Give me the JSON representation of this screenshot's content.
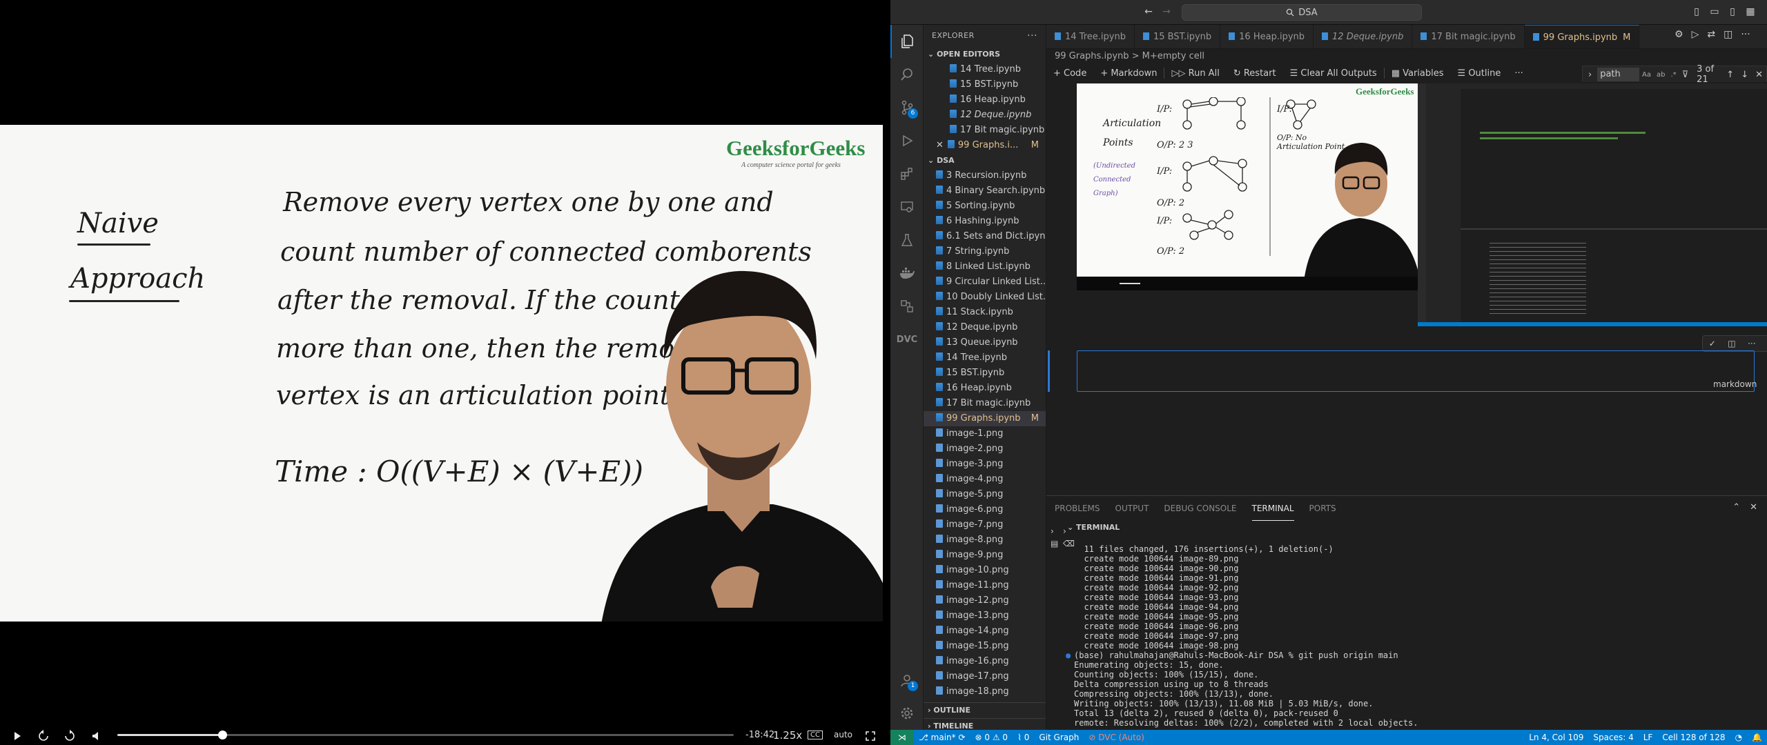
{
  "video": {
    "logo": "GeeksforGeeks",
    "logo_sub": "A computer science portal for geeks",
    "slide": {
      "heading_line1": "Naive",
      "heading_line2": "Approach",
      "body_lines": [
        "Remove every vertex one by one and",
        "count number of connected comborents",
        "after the removal. If the count is",
        "more than one, then the removed",
        "vertex is an articulation point."
      ],
      "time": "Time : O((V+E) × (V+E))"
    },
    "controls": {
      "time_remaining": "-18:42",
      "speed": "1.25x",
      "quality": "auto",
      "progress_fraction": 0.17
    }
  },
  "vscode": {
    "title": "DSA",
    "sidebar": {
      "header": "EXPLORER",
      "open_editors_label": "OPEN EDITORS",
      "open_editors": [
        {
          "label": "14 Tree.ipynb"
        },
        {
          "label": "15 BST.ipynb"
        },
        {
          "label": "16 Heap.ipynb"
        },
        {
          "label": "12 Deque.ipynb",
          "italic": true
        },
        {
          "label": "17 Bit magic.ipynb"
        },
        {
          "label": "99 Graphs.i...",
          "mod": "M",
          "active": true
        }
      ],
      "folder_label": "DSA",
      "files": [
        "3 Recursion.ipynb",
        "4 Binary Search.ipynb",
        "5 Sorting.ipynb",
        "6 Hashing.ipynb",
        "6.1 Sets and Dict.ipynb",
        "7 String.ipynb",
        "8 Linked List.ipynb",
        "9 Circular Linked List....",
        "10 Doubly Linked List....",
        "11 Stack.ipynb",
        "12 Deque.ipynb",
        "13 Queue.ipynb",
        "14 Tree.ipynb",
        "15 BST.ipynb",
        "16 Heap.ipynb",
        "17 Bit magic.ipynb"
      ],
      "active_file": {
        "label": "99 Graphs.ipynb",
        "mod": "M"
      },
      "images": [
        "image-1.png",
        "image-2.png",
        "image-3.png",
        "image-4.png",
        "image-5.png",
        "image-6.png",
        "image-7.png",
        "image-8.png",
        "image-9.png",
        "image-10.png",
        "image-11.png",
        "image-12.png",
        "image-13.png",
        "image-14.png",
        "image-15.png",
        "image-16.png",
        "image-17.png",
        "image-18.png"
      ],
      "outline_label": "OUTLINE",
      "timeline_label": "TIMELINE"
    },
    "tabs": [
      {
        "label": "14 Tree.ipynb"
      },
      {
        "label": "15 BST.ipynb"
      },
      {
        "label": "16 Heap.ipynb"
      },
      {
        "label": "12 Deque.ipynb",
        "italic": true
      },
      {
        "label": "17 Bit magic.ipynb"
      },
      {
        "label": "99 Graphs.ipynb",
        "mod": "M",
        "active": true
      }
    ],
    "breadcrumb": "99 Graphs.ipynb > M+empty cell",
    "toolbar": {
      "code": "Code",
      "markdown": "Markdown",
      "run_all": "Run All",
      "restart": "Restart",
      "clear": "Clear All Outputs",
      "variables": "Variables",
      "outline": "Outline",
      "more": "···"
    },
    "find": {
      "value": "path",
      "count": "3 of 21"
    },
    "cell": {
      "lang": "markdown"
    },
    "screenshot_text": {
      "articulation": "Articulation",
      "points": "Points",
      "undirected": "(Undirected Connected Graph)",
      "ip": "I/P:",
      "op1": "O/P: 2 3",
      "op2": "O/P: 2",
      "op3": "O/P: 2",
      "op4": "O/P: No Articulation Point"
    },
    "panel": {
      "tabs": [
        "PROBLEMS",
        "OUTPUT",
        "DEBUG CONSOLE",
        "TERMINAL",
        "PORTS"
      ],
      "active_tab": "TERMINAL",
      "terminal_label": "TERMINAL",
      "lines": [
        "  11 files changed, 176 insertions(+), 1 deletion(-)",
        "  create mode 100644 image-89.png",
        "  create mode 100644 image-90.png",
        "  create mode 100644 image-91.png",
        "  create mode 100644 image-92.png",
        "  create mode 100644 image-93.png",
        "  create mode 100644 image-94.png",
        "  create mode 100644 image-95.png",
        "  create mode 100644 image-96.png",
        "  create mode 100644 image-97.png",
        "  create mode 100644 image-98.png",
        "(base) rahulmahajan@Rahuls-MacBook-Air DSA % git push origin main",
        "Enumerating objects: 15, done.",
        "Counting objects: 100% (15/15), done.",
        "Delta compression using up to 8 threads",
        "Compressing objects: 100% (13/13), done.",
        "Writing objects: 100% (13/13), 11.08 MiB | 5.03 MiB/s, done.",
        "Total 13 (delta 2), reused 0 (delta 0), pack-reused 0",
        "remote: Resolving deltas: 100% (2/2), completed with 2 local objects."
      ]
    },
    "status": {
      "branch": "main*",
      "errors": "0",
      "warnings": "0",
      "ports": "0",
      "git_graph": "Git Graph",
      "dvc": "DVC (Auto)",
      "position": "Ln 4, Col 109",
      "spaces": "Spaces: 4",
      "eol": "LF",
      "cell": "Cell 128 of 128"
    },
    "badges": {
      "scm": "6",
      "account": "1"
    },
    "colors": {
      "accent": "#007acc",
      "modified": "#e2c08d",
      "gfg": "#2f8d46"
    }
  }
}
